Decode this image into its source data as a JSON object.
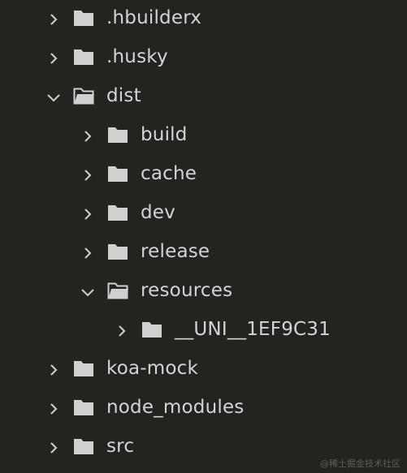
{
  "explorer": {
    "items": [
      {
        "label": ".hbuilderx",
        "expanded": false,
        "icon": "folder-icon"
      },
      {
        "label": ".husky",
        "expanded": false,
        "icon": "folder-icon"
      },
      {
        "label": "dist",
        "expanded": true,
        "icon": "folder-open-icon"
      },
      {
        "label": "build",
        "expanded": false,
        "icon": "folder-icon"
      },
      {
        "label": "cache",
        "expanded": false,
        "icon": "folder-icon"
      },
      {
        "label": "dev",
        "expanded": false,
        "icon": "folder-icon"
      },
      {
        "label": "release",
        "expanded": false,
        "icon": "folder-icon"
      },
      {
        "label": "resources",
        "expanded": true,
        "icon": "folder-open-icon"
      },
      {
        "label": "__UNI__1EF9C31",
        "expanded": false,
        "icon": "folder-icon"
      },
      {
        "label": "koa-mock",
        "expanded": false,
        "icon": "folder-icon"
      },
      {
        "label": "node_modules",
        "expanded": false,
        "icon": "folder-icon"
      },
      {
        "label": "src",
        "expanded": false,
        "icon": "folder-icon"
      }
    ]
  },
  "watermark": "@稀土掘金技术社区",
  "colors": {
    "background": "#23241f",
    "text": "#d4d4d4",
    "icon": "#d0d0d0"
  }
}
